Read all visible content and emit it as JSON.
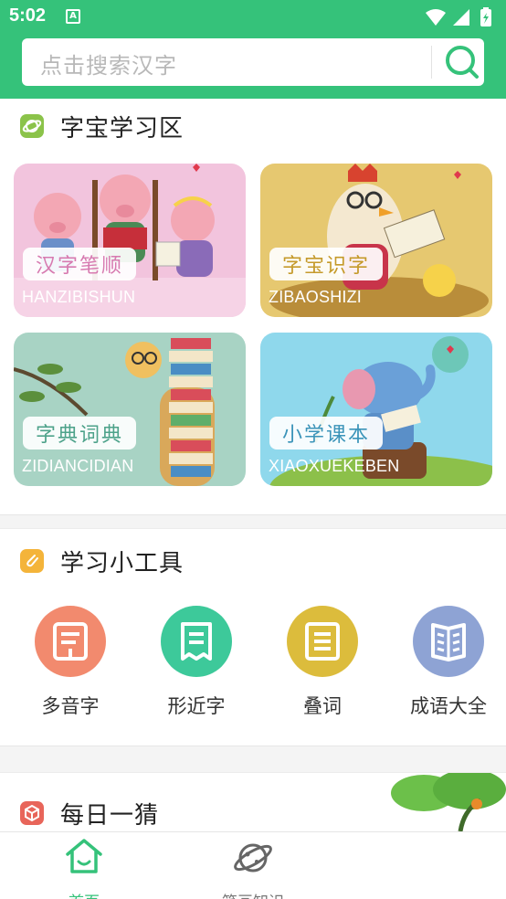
{
  "status_bar": {
    "time": "5:02",
    "notification_icon": "A"
  },
  "search": {
    "placeholder": "点击搜索汉字"
  },
  "colors": {
    "brand": "#35c27a",
    "tool_1": "#f28a6e",
    "tool_2": "#3dc99a",
    "tool_3": "#dcbc3c",
    "tool_4": "#8ea3d4"
  },
  "study_area": {
    "title": "字宝学习区",
    "cards": [
      {
        "label": "汉字笔顺",
        "pinyin": "HANZIBISHUN",
        "label_color": "#d77ab0"
      },
      {
        "label": "字宝识字",
        "pinyin": "ZIBAOSHIZI",
        "label_color": "#c59a2a"
      },
      {
        "label": "字典词典",
        "pinyin": "ZIDIANCIDIAN",
        "label_color": "#4da28a"
      },
      {
        "label": "小学课本",
        "pinyin": "XIAOXUEKEBEN",
        "label_color": "#3b94b9"
      }
    ]
  },
  "tools": {
    "title": "学习小工具",
    "items": [
      {
        "label": "多音字",
        "icon": "document-icon"
      },
      {
        "label": "形近字",
        "icon": "receipt-icon"
      },
      {
        "label": "叠词",
        "icon": "page-icon"
      },
      {
        "label": "成语大全",
        "icon": "book-icon"
      }
    ]
  },
  "daily": {
    "title": "每日一猜"
  },
  "bottom_nav": {
    "items": [
      {
        "label": "首页",
        "icon": "home-icon",
        "active": true
      },
      {
        "label": "笔画知识",
        "icon": "planet-icon",
        "active": false
      }
    ]
  }
}
